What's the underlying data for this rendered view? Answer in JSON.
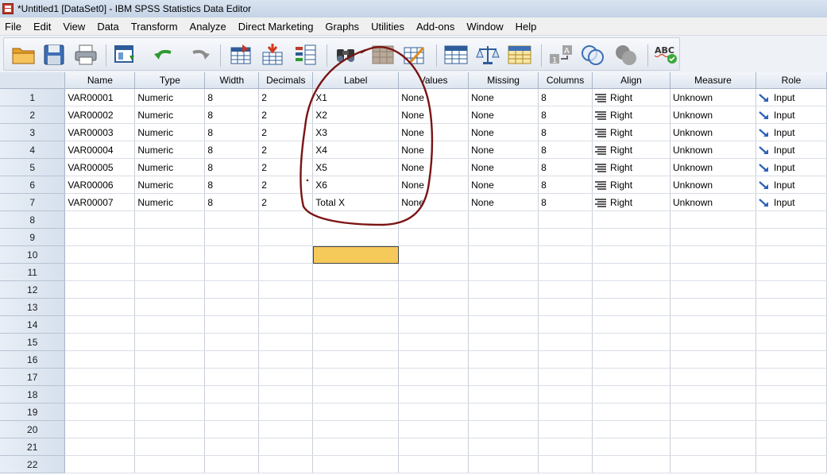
{
  "window": {
    "title": "*Untitled1 [DataSet0] - IBM SPSS Statistics Data Editor"
  },
  "menu": {
    "items": [
      "File",
      "Edit",
      "View",
      "Data",
      "Transform",
      "Analyze",
      "Direct Marketing",
      "Graphs",
      "Utilities",
      "Add-ons",
      "Window",
      "Help"
    ]
  },
  "toolbar": {
    "icons": [
      "open-folder-icon",
      "save-icon",
      "print-icon",
      "recall-dialog-icon",
      "undo-icon",
      "redo-icon",
      "go-to-case-icon",
      "go-to-variable-icon",
      "variables-icon",
      "find-icon",
      "insert-cases-icon",
      "insert-variable-icon",
      "split-file-icon",
      "weight-cases-icon",
      "select-cases-icon",
      "value-labels-icon",
      "use-sets-icon",
      "show-all-variables-icon",
      "spell-check-icon"
    ]
  },
  "grid": {
    "columns": [
      "Name",
      "Type",
      "Width",
      "Decimals",
      "Label",
      "Values",
      "Missing",
      "Columns",
      "Align",
      "Measure",
      "Role"
    ],
    "rows": [
      [
        "VAR00001",
        "Numeric",
        "8",
        "2",
        "X1",
        "None",
        "None",
        "8",
        "Right",
        "Unknown",
        "Input"
      ],
      [
        "VAR00002",
        "Numeric",
        "8",
        "2",
        "X2",
        "None",
        "None",
        "8",
        "Right",
        "Unknown",
        "Input"
      ],
      [
        "VAR00003",
        "Numeric",
        "8",
        "2",
        "X3",
        "None",
        "None",
        "8",
        "Right",
        "Unknown",
        "Input"
      ],
      [
        "VAR00004",
        "Numeric",
        "8",
        "2",
        "X4",
        "None",
        "None",
        "8",
        "Right",
        "Unknown",
        "Input"
      ],
      [
        "VAR00005",
        "Numeric",
        "8",
        "2",
        "X5",
        "None",
        "None",
        "8",
        "Right",
        "Unknown",
        "Input"
      ],
      [
        "VAR00006",
        "Numeric",
        "8",
        "2",
        "X6",
        "None",
        "None",
        "8",
        "Right",
        "Unknown",
        "Input"
      ],
      [
        "VAR00007",
        "Numeric",
        "8",
        "2",
        "Total X",
        "None",
        "None",
        "8",
        "Right",
        "Unknown",
        "Input"
      ]
    ],
    "row_numbers": [
      "1",
      "2",
      "3",
      "4",
      "5",
      "6",
      "7",
      "8",
      "9",
      "10",
      "11",
      "12",
      "13",
      "14",
      "15",
      "16",
      "17",
      "18",
      "19",
      "20",
      "21",
      "22"
    ],
    "selected_cell": {
      "row": 10,
      "column": "Label"
    }
  },
  "colors": {
    "selected_cell": "#f5c95a",
    "annotation": "#7a1414",
    "header_bg": "#dde5f0"
  }
}
